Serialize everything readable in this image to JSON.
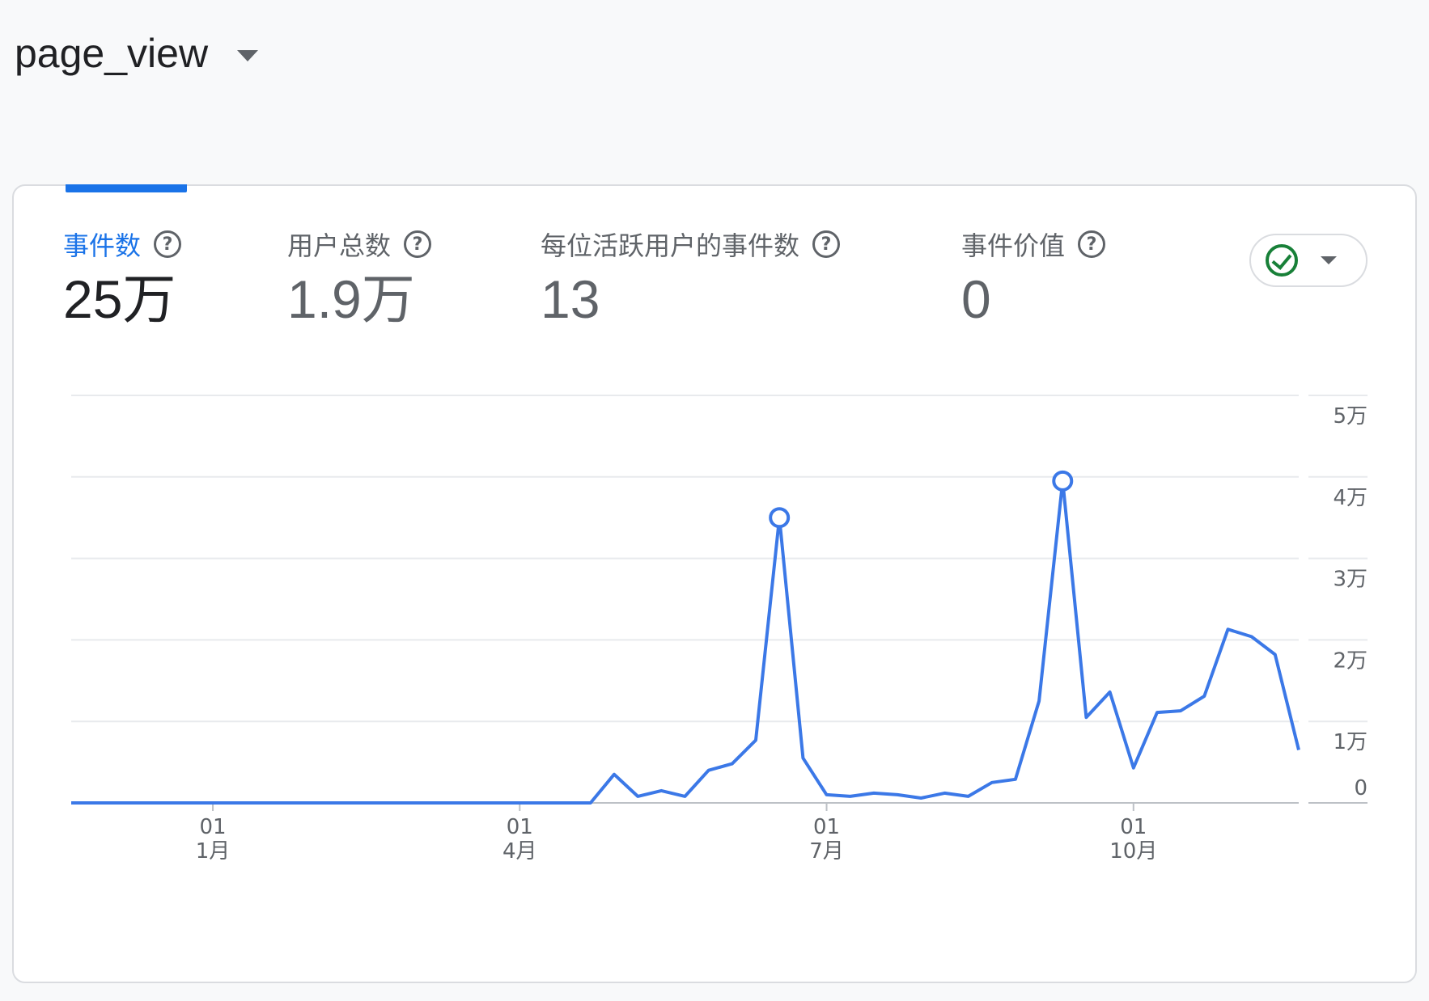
{
  "header": {
    "event_name": "page_view"
  },
  "metrics": [
    {
      "label": "事件数",
      "value": "25万",
      "active": true
    },
    {
      "label": "用户总数",
      "value": "1.9万",
      "active": false
    },
    {
      "label": "每位活跃用户的事件数",
      "value": "13",
      "active": false
    },
    {
      "label": "事件价值",
      "value": "0",
      "active": false
    }
  ],
  "icons": {
    "help": "question-circle-icon",
    "status": "check-circle-icon",
    "caret": "caret-down-icon"
  },
  "colors": {
    "accent": "#1a73e8",
    "line": "#3b78e7",
    "status_ok": "#188038"
  },
  "chart_data": {
    "type": "line",
    "xlabel": "",
    "ylabel": "",
    "ylim": [
      0,
      50000
    ],
    "y_ticks": [
      {
        "value": 0,
        "label": "0"
      },
      {
        "value": 10000,
        "label": "1万"
      },
      {
        "value": 20000,
        "label": "2万"
      },
      {
        "value": 30000,
        "label": "3万"
      },
      {
        "value": 40000,
        "label": "4万"
      },
      {
        "value": 50000,
        "label": "5万"
      }
    ],
    "x_ticks": [
      {
        "week": 6,
        "day": "01",
        "month": "1月"
      },
      {
        "week": 19,
        "day": "01",
        "month": "4月"
      },
      {
        "week": 32,
        "day": "01",
        "month": "7月"
      },
      {
        "week": 45,
        "day": "01",
        "month": "10月"
      }
    ],
    "x_range": [
      0,
      52
    ],
    "series": [
      {
        "name": "",
        "values": [
          0,
          0,
          0,
          0,
          0,
          0,
          0,
          0,
          0,
          0,
          0,
          0,
          0,
          0,
          0,
          0,
          0,
          0,
          0,
          0,
          0,
          0,
          0,
          3500,
          800,
          1500,
          800,
          4000,
          4800,
          7700,
          35000,
          5500,
          1000,
          800,
          1200,
          1000,
          600,
          1200,
          800,
          2500,
          2900,
          12500,
          39500,
          10500,
          13600,
          4300,
          11100,
          11300,
          13100,
          21300,
          20400,
          18200,
          6500
        ],
        "highlight_indices": [
          30,
          42
        ]
      }
    ]
  }
}
